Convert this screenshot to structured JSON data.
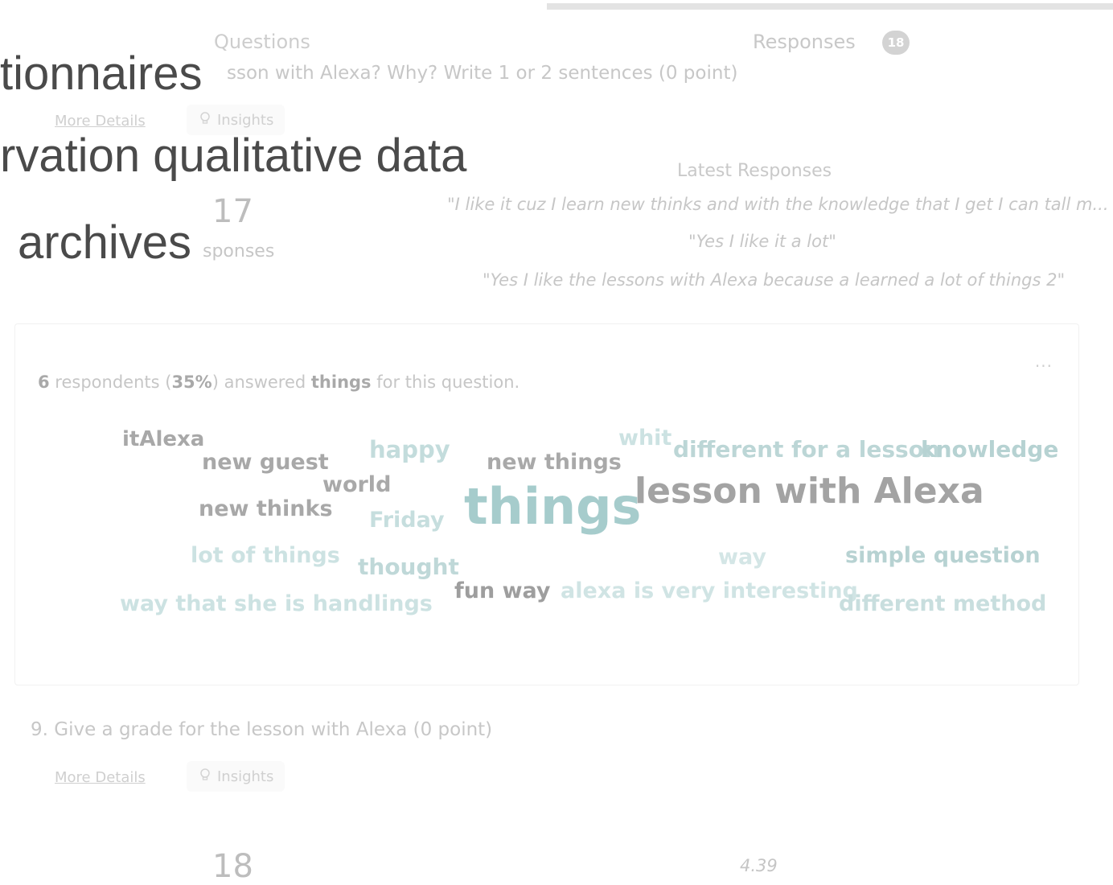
{
  "tabs": {
    "questions": "Questions",
    "responses": "Responses",
    "responses_count": "18"
  },
  "slide_overlay": {
    "line1": "tionnaires",
    "line2": "rvation qualitative data",
    "line3": "archives"
  },
  "question8": {
    "title_fragment": "sson with Alexa? Why? Write 1 or 2 sentences  (0 point)",
    "more_details": "More Details",
    "insights": "Insights",
    "responses_count": "17",
    "responses_label": "sponses",
    "latest_title": "Latest Responses",
    "latest": [
      "\"I like it cuz I learn new thinks and with the knowledge that I get I can tall m...",
      "\"Yes I like it a lot\"",
      "\"Yes I like the lessons with Alexa because a learned a lot of things 2\""
    ]
  },
  "word_cloud": {
    "menu": "...",
    "summary": {
      "count": "6",
      "text1": " respondents (",
      "percent": "35%",
      "text2": ") answered ",
      "term": "things",
      "text3": " for this question."
    },
    "words": [
      {
        "text": "itAlexa",
        "color": "#a8a8a8"
      },
      {
        "text": "new guest",
        "color": "#a8a8a8"
      },
      {
        "text": "happy",
        "color": "#c3dcdc"
      },
      {
        "text": "new things",
        "color": "#a9a9a9"
      },
      {
        "text": "whit",
        "color": "#cce2e2"
      },
      {
        "text": "different for a lesson",
        "color": "#bcd6d6"
      },
      {
        "text": "knowledge",
        "color": "#b6d2d2"
      },
      {
        "text": "world",
        "color": "#a9a9a9"
      },
      {
        "text": "new thinks",
        "color": "#a8a8a8"
      },
      {
        "text": "Friday",
        "color": "#c6dede"
      },
      {
        "text": "things",
        "color": "#a6cccc"
      },
      {
        "text": "lesson with Alexa",
        "color": "#a3a3a3"
      },
      {
        "text": "lot of things",
        "color": "#cce2e2"
      },
      {
        "text": "thought",
        "color": "#bfd8d8"
      },
      {
        "text": "way",
        "color": "#d4e6e6"
      },
      {
        "text": "simple question",
        "color": "#b7d2d2"
      },
      {
        "text": "way that she is handlings",
        "color": "#cce2e2"
      },
      {
        "text": "fun way",
        "color": "#9e9e9e"
      },
      {
        "text": "alexa is very interesting",
        "color": "#d0e4e4"
      },
      {
        "text": "different method",
        "color": "#c8dede"
      }
    ]
  },
  "question9": {
    "title": "9.  Give a grade for the lesson with Alexa  (0 point)",
    "more_details": "More Details",
    "insights": "Insights",
    "responses_count": "18",
    "average": "4.39"
  }
}
